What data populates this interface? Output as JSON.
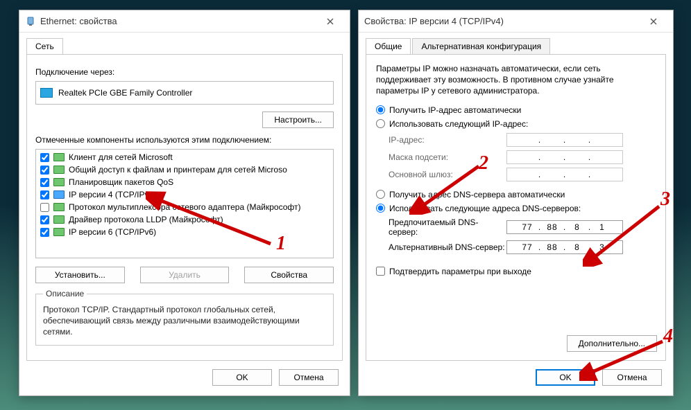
{
  "left": {
    "title": "Ethernet: свойства",
    "tab_network": "Сеть",
    "connect_via_label": "Подключение через:",
    "adapter_name": "Realtek PCIe GBE Family Controller",
    "configure_btn": "Настроить...",
    "components_label": "Отмеченные компоненты используются этим подключением:",
    "components": [
      {
        "checked": true,
        "label": "Клиент для сетей Microsoft"
      },
      {
        "checked": true,
        "label": "Общий доступ к файлам и принтерам для сетей Microso"
      },
      {
        "checked": true,
        "label": "Планировщик пакетов QoS"
      },
      {
        "checked": true,
        "label": "IP версии 4 (TCP/IPv4)"
      },
      {
        "checked": false,
        "label": "Протокол мультиплексора сетевого адаптера (Майкрософт)"
      },
      {
        "checked": true,
        "label": "Драйвер протокола LLDP (Майкрософт)"
      },
      {
        "checked": true,
        "label": "IP версии 6 (TCP/IPv6)"
      }
    ],
    "install_btn": "Установить...",
    "remove_btn": "Удалить",
    "props_btn": "Свойства",
    "desc_legend": "Описание",
    "desc_text": "Протокол TCP/IP. Стандартный протокол глобальных сетей, обеспечивающий связь между различными взаимодействующими сетями.",
    "ok": "OK",
    "cancel": "Отмена"
  },
  "right": {
    "title": "Свойства: IP версии 4 (TCP/IPv4)",
    "tab_general": "Общие",
    "tab_alt": "Альтернативная конфигурация",
    "info": "Параметры IP можно назначать автоматически, если сеть поддерживает эту возможность. В противном случае узнайте параметры IP у сетевого администратора.",
    "radio_ip_auto": "Получить IP-адрес автоматически",
    "radio_ip_manual": "Использовать следующий IP-адрес:",
    "ip_label": "IP-адрес:",
    "mask_label": "Маска подсети:",
    "gw_label": "Основной шлюз:",
    "radio_dns_auto": "Получить адрес DNS-сервера автоматически",
    "radio_dns_manual": "Использовать следующие адреса DNS-серверов:",
    "dns1_label": "Предпочитаемый DNS-сервер:",
    "dns2_label": "Альтернативный DNS-сервер:",
    "dns1": {
      "a": "77",
      "b": "88",
      "c": "8",
      "d": "1"
    },
    "dns2": {
      "a": "77",
      "b": "88",
      "c": "8",
      "d": "3"
    },
    "validate_label": "Подтвердить параметры при выходе",
    "advanced_btn": "Дополнительно...",
    "ok": "OK",
    "cancel": "Отмена"
  },
  "annotations": {
    "n1": "1",
    "n2": "2",
    "n3": "3",
    "n4": "4"
  }
}
